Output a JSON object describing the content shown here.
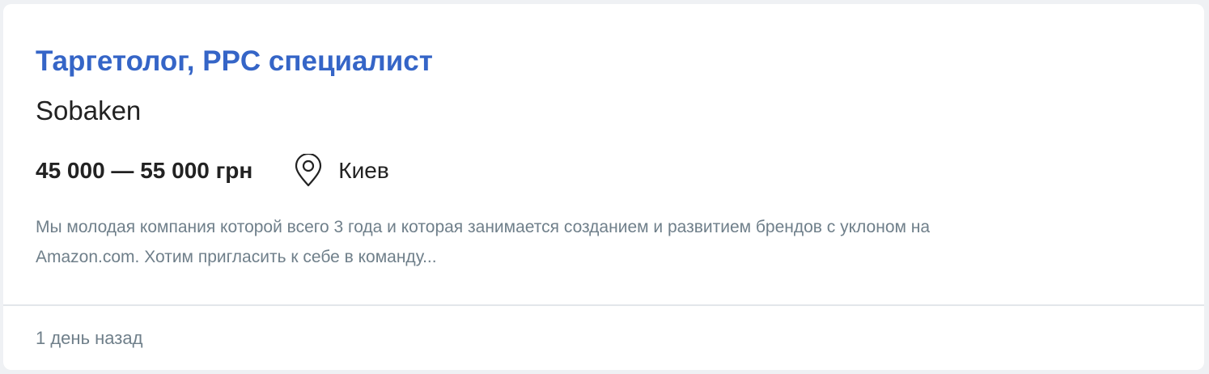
{
  "job": {
    "title": "Таргетолог, PPC специалист",
    "company": "Sobaken",
    "salary": "45 000 — 55 000 грн",
    "location": "Киев",
    "description": "Мы молодая компания которой всего 3 года и которая занимается созданием и развитием брендов с уклоном на Amazon.com. Хотим пригласить к себе в команду...",
    "posted": "1 день назад"
  },
  "icons": {
    "location": "map-pin-icon"
  },
  "colors": {
    "title_link": "#3565c7",
    "muted_text": "#6f7f8a",
    "primary_text": "#222222",
    "background": "#eff1f4",
    "card": "#ffffff"
  }
}
